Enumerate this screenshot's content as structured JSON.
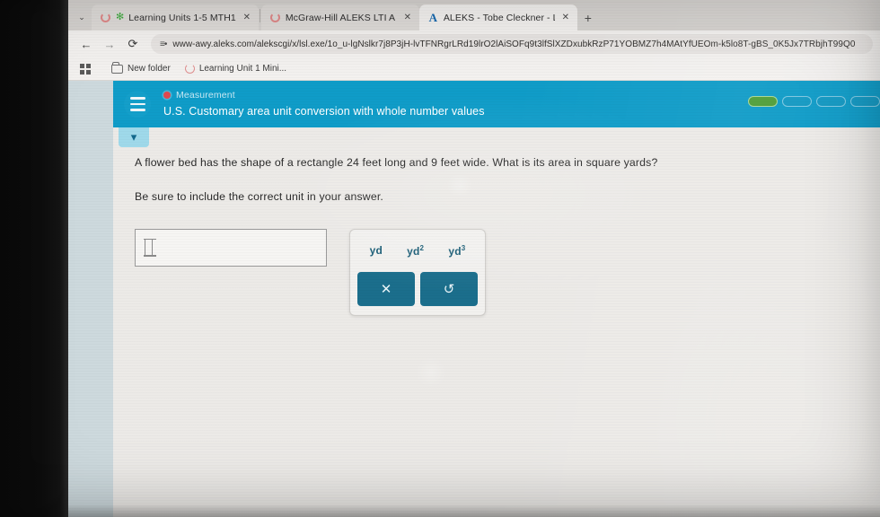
{
  "browser": {
    "tabs": [
      {
        "title": "Learning Units 1-5  MTH1",
        "favicon": "loading-ring-icon",
        "active": false,
        "close_label": "✕"
      },
      {
        "title": "McGraw-Hill ALEKS LTI A (Can",
        "favicon": "loading-ring-icon",
        "active": false,
        "close_label": "✕"
      },
      {
        "title": "ALEKS - Tobe Cleckner - Learn",
        "favicon": "aleks-a-icon",
        "active": true,
        "close_label": "✕"
      }
    ],
    "new_tab_label": "+",
    "tab_list_chevron": "⌄",
    "nav": {
      "back": "←",
      "forward": "→",
      "reload": "⟳"
    },
    "omnibox": {
      "site_icon": "site-settings-icon",
      "url": "www-awy.aleks.com/alekscgi/x/lsl.exe/1o_u-lgNslkr7j8P3jH-lvTFNRgrLRd19lrO2lAiSOFq9t3lfSlXZDxubkRzP71YOBMZ7h4MAtYfUEOm-k5lo8T-gBS_0K5Jx7TRbjhT99Q0"
    },
    "bookmarks": [
      {
        "label": "New folder",
        "icon": "folder-icon"
      },
      {
        "label": "Learning Unit 1 Mini...",
        "icon": "loading-ring-icon"
      }
    ],
    "apps_icon": "apps-grid-icon"
  },
  "aleks": {
    "menu_icon": "hamburger-menu-icon",
    "topic": "Measurement",
    "topic_dot_color": "#e0484f",
    "lesson_title": "U.S. Customary area unit conversion with whole number values",
    "header_color": "#0f9cc8",
    "collapse_icon": "chevron-down-icon",
    "progress": {
      "segments": [
        {
          "state": "done"
        },
        {
          "state": "empty"
        },
        {
          "state": "empty"
        },
        {
          "state": "empty"
        }
      ],
      "done_color": "#4f9e38"
    }
  },
  "question": {
    "prompt": "A flower bed has the shape of a rectangle 24 feet long and 9 feet wide. What is its area in square yards?",
    "instruction": "Be sure to include the correct unit in your answer."
  },
  "answer": {
    "input_value": "",
    "input_placeholder": "",
    "caret_icon": "text-caret-icon"
  },
  "keypad": {
    "units": [
      {
        "label": "yd",
        "sup": ""
      },
      {
        "label": "yd",
        "sup": "2"
      },
      {
        "label": "yd",
        "sup": "3"
      }
    ],
    "actions": [
      {
        "name": "clear-button",
        "glyph": "✕"
      },
      {
        "name": "undo-button",
        "glyph": "↺"
      }
    ],
    "accent_color": "#1b6e8c",
    "unit_text_color": "#1d5f78"
  }
}
